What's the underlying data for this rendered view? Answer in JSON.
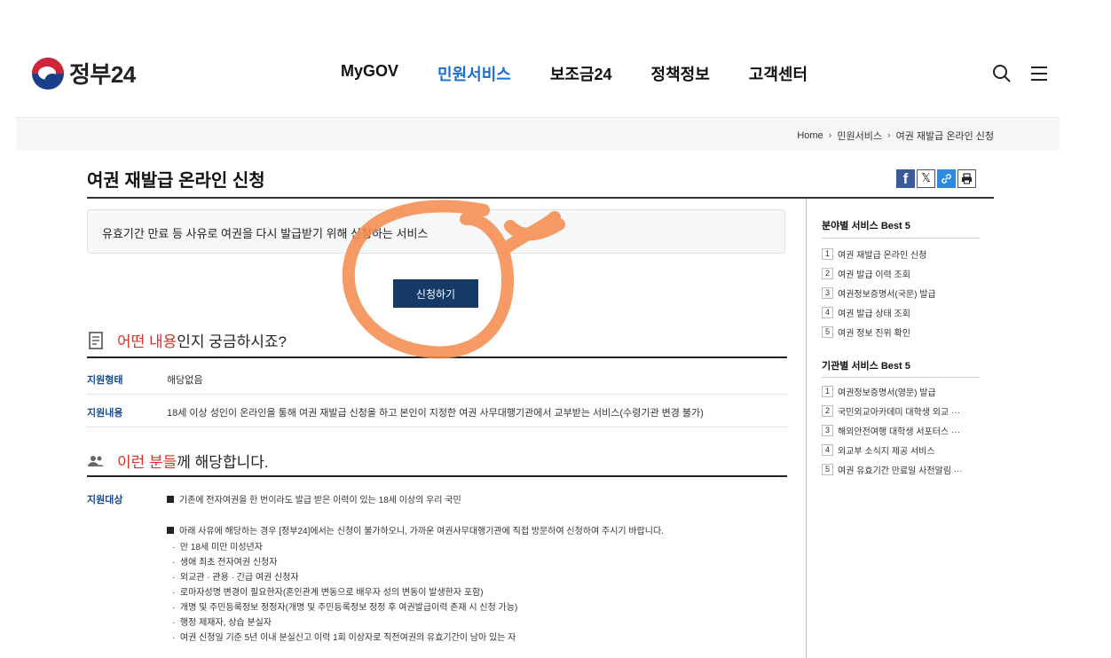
{
  "header": {
    "logo_text": "정부24",
    "nav": [
      "MyGOV",
      "민원서비스",
      "보조금24",
      "정책정보",
      "고객센터"
    ],
    "active_nav": "민원서비스"
  },
  "breadcrumb": [
    "Home",
    "민원서비스",
    "여권 재발급 온라인 신청"
  ],
  "page": {
    "title": "여권 재발급 온라인 신청",
    "summary": "유효기간 만료 등 사유로 여권을 다시 발급받기 위해 신청하는 서비스",
    "apply_label": "신청하기"
  },
  "section_what": {
    "title_hl": "어떤 내용",
    "title_rest": "인지 궁금하시죠?",
    "rows": [
      {
        "key": "지원형태",
        "value": "해당없음"
      },
      {
        "key": "지원내용",
        "value": "18세 이상 성인이 온라인을 통해 여권 재발급 신청을 하고 본인이 지정한 여권 사무대행기관에서 교부받는 서비스(수령기관 변경 불가)"
      }
    ]
  },
  "section_who": {
    "title_hl": "이런 분들",
    "title_rest": "께 해당합니다.",
    "key": "지원대상",
    "line1": "기존에 전자여권을 한 번이라도 발급 받은 이력이 있는 18세 이상의 우리 국민",
    "line2": "아래 사유에 해당하는 경우 [정부24]에서는 신청이 불가하오니, 가까운 여권사무대행기관에 직접 방문하여 신청하여 주시기 바랍니다.",
    "subs": [
      "만 18세 미만 미성년자",
      "생애 최초 전자여권 신청자",
      "외교관 · 관용 · 긴급 여권 신청자",
      "로마자성명 변경이 필요한자(혼인관계 변동으로 배우자 성의 변동이 발생한자 포함)",
      "개명 및 주민등록정보 정정자(개명 및 주민등록정보 정정 후 여권발급이력 존재 시 신청 가능)",
      "행정 제재자, 상습 분실자",
      "여권 신청일 기준 5년 이내 분실신고 이력 1회 이상자로 직전여권의 유효기간이 남아 있는 자"
    ]
  },
  "sidebar": {
    "field_title": "분야별 서비스 Best 5",
    "field_items": [
      "여권 재발급 온라인 신청",
      "여권 발급 이력 조회",
      "여권정보증명서(국문) 발급",
      "여권 발급 상태 조회",
      "여권 정보 진위 확인"
    ],
    "org_title": "기관별 서비스 Best 5",
    "org_items": [
      "여권정보증명서(영문) 발급",
      "국민외교아카데미 대학생 외교 ···",
      "해외안전여행 대학생 서포터스 ···",
      "외교부 소식지 제공 서비스",
      "여권 유효기간 만료일 사전알림 ···"
    ]
  },
  "icons": [
    "search-icon",
    "menu-icon",
    "facebook-icon",
    "x-icon",
    "link-icon",
    "print-icon",
    "document-icon",
    "people-icon"
  ],
  "colors": {
    "accent": "#1a6dd1",
    "button": "#163a67",
    "highlight": "#d6332a",
    "key": "#1a4b8c"
  }
}
